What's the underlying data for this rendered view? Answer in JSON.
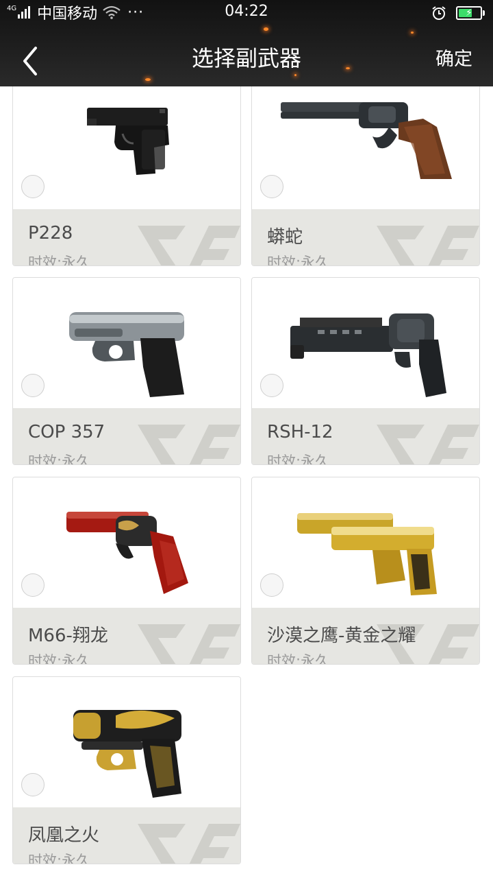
{
  "status_bar": {
    "network": "4G",
    "carrier": "中国移动",
    "more": "···",
    "time": "04:22",
    "battery_level": 0.6,
    "battery_color": "#3ddc6a"
  },
  "header": {
    "title": "选择副武器",
    "confirm_label": "确定",
    "back_icon": "chevron-left-icon"
  },
  "items": [
    {
      "name": "P228",
      "duration": "时效:永久",
      "icon": "pistol-p228-icon",
      "selected": false
    },
    {
      "name": "蟒蛇",
      "duration": "时效:永久",
      "icon": "revolver-python-icon",
      "selected": false
    },
    {
      "name": "COP 357",
      "duration": "时效:永久",
      "icon": "derringer-cop357-icon",
      "selected": false
    },
    {
      "name": "RSH-12",
      "duration": "时效:永久",
      "icon": "revolver-rsh12-icon",
      "selected": false
    },
    {
      "name": "M66-翔龙",
      "duration": "时效:永久",
      "icon": "revolver-m66-dragon-icon",
      "selected": false
    },
    {
      "name": "沙漠之鹰-黄金之耀",
      "duration": "时效:永久",
      "icon": "pistol-desert-eagle-gold-icon",
      "selected": false
    },
    {
      "name": "凤凰之火",
      "duration": "时效:永久",
      "icon": "derringer-phoenix-icon",
      "selected": false
    }
  ],
  "colors": {
    "header_bg": "#1c1c1c",
    "card_footer_bg": "#e6e6e2",
    "name_text": "#4b4b4b",
    "duration_text": "#9a9a9a"
  }
}
